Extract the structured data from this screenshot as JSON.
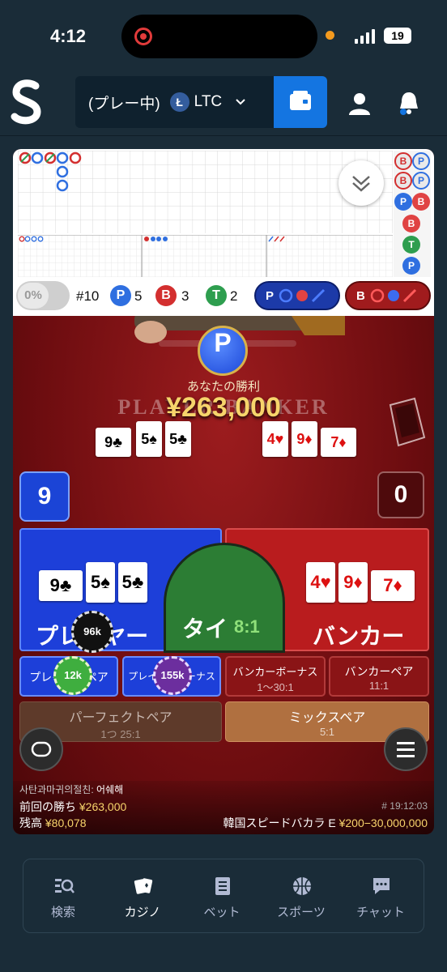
{
  "status_bar": {
    "time": "4:12",
    "battery": "19"
  },
  "header": {
    "status": "(プレー中)",
    "currency_icon": "Ł",
    "currency": "LTC",
    "icons": [
      "logo-icon",
      "chevron-down-icon",
      "wallet-icon",
      "user-icon",
      "bell-icon"
    ]
  },
  "roadmap": {
    "stats": {
      "percent": "0%",
      "round": "#10",
      "player_badge": "P",
      "player_count": "5",
      "banker_badge": "B",
      "banker_count": "3",
      "tie_badge": "T",
      "tie_count": "2"
    },
    "predict_player": "P",
    "predict_banker": "B",
    "side_road": [
      "B",
      "P",
      "B",
      "P",
      "B",
      "T",
      "P"
    ]
  },
  "table": {
    "result_badge": "P",
    "win_label": "あなたの勝利",
    "win_amount": "¥263,000",
    "table_words": "PLAYER          BANKER",
    "player_cards": [
      {
        "rank": "9",
        "suit": "♣"
      },
      {
        "rank": "5",
        "suit": "♠"
      },
      {
        "rank": "5",
        "suit": "♣"
      }
    ],
    "banker_cards": [
      {
        "rank": "4",
        "suit": "♥"
      },
      {
        "rank": "9",
        "suit": "♦"
      },
      {
        "rank": "7",
        "suit": "♦"
      }
    ],
    "player_score": "9",
    "banker_score": "0"
  },
  "bets": {
    "player_label": "プレイヤー",
    "player_chip": "96k",
    "tie_label": "タイ",
    "tie_odds": "8:1",
    "banker_label": "バンカー",
    "player_pair_label": "プレイヤーペア",
    "player_pair_chip": "12k",
    "player_bonus_label": "プレイヤーボーナス",
    "player_bonus_chip": "155k",
    "banker_bonus_label": "バンカーボーナス",
    "banker_bonus_odds": "1〜30:1",
    "banker_pair_label": "バンカーペア",
    "banker_pair_odds": "11:1",
    "perfect_pair_label": "パーフェクトペア",
    "perfect_pair_odds": "1つ 25:1",
    "mix_pair_label": "ミックスペア",
    "mix_pair_odds": "5:1"
  },
  "info": {
    "chat_user": "사탄과마귀의절친:",
    "chat_message": "어쉐해",
    "last_win_label": "前回の勝ち",
    "last_win_amount": "¥263,000",
    "round_id": "# 19:12:03",
    "balance_label": "残高",
    "balance_amount": "¥80,078",
    "table_name": "韓国スピードバカラ E",
    "table_limits": "¥200−30,000,000"
  },
  "nav": [
    {
      "label": "検索",
      "icon": "search-icon"
    },
    {
      "label": "カジノ",
      "icon": "casino-cards-icon"
    },
    {
      "label": "ベット",
      "icon": "bet-slip-icon"
    },
    {
      "label": "スポーツ",
      "icon": "basketball-icon"
    },
    {
      "label": "チャット",
      "icon": "chat-icon"
    }
  ],
  "colors": {
    "background": "#1a2c38",
    "accent_blue": "#1475e1",
    "player_blue": "#1d3fd9",
    "banker_red": "#b91c1e",
    "tie_green": "#2c7d34",
    "gold": "#f7d46b"
  }
}
